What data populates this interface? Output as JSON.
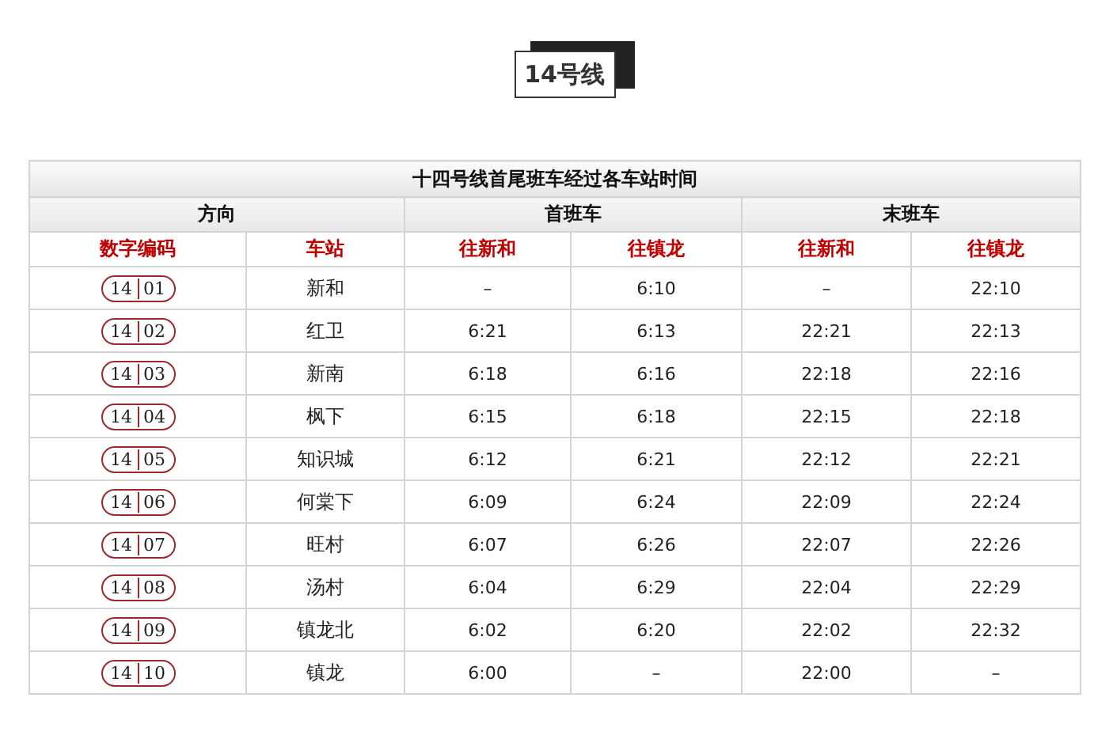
{
  "heading": "14号线",
  "table": {
    "title": "十四号线首尾班车经过各车站时间",
    "groups": [
      "方向",
      "首班车",
      "末班车"
    ],
    "columns": [
      "数字编码",
      "车站",
      "往新和",
      "往镇龙",
      "往新和",
      "往镇龙"
    ],
    "rows": [
      {
        "line": "14",
        "code": "01",
        "station": "新和",
        "times": [
          "–",
          "6:10",
          "–",
          "22:10"
        ]
      },
      {
        "line": "14",
        "code": "02",
        "station": "红卫",
        "times": [
          "6:21",
          "6:13",
          "22:21",
          "22:13"
        ]
      },
      {
        "line": "14",
        "code": "03",
        "station": "新南",
        "times": [
          "6:18",
          "6:16",
          "22:18",
          "22:16"
        ]
      },
      {
        "line": "14",
        "code": "04",
        "station": "枫下",
        "times": [
          "6:15",
          "6:18",
          "22:15",
          "22:18"
        ]
      },
      {
        "line": "14",
        "code": "05",
        "station": "知识城",
        "times": [
          "6:12",
          "6:21",
          "22:12",
          "22:21"
        ]
      },
      {
        "line": "14",
        "code": "06",
        "station": "何棠下",
        "times": [
          "6:09",
          "6:24",
          "22:09",
          "22:24"
        ]
      },
      {
        "line": "14",
        "code": "07",
        "station": "旺村",
        "times": [
          "6:07",
          "6:26",
          "22:07",
          "22:26"
        ]
      },
      {
        "line": "14",
        "code": "08",
        "station": "汤村",
        "times": [
          "6:04",
          "6:29",
          "22:04",
          "22:29"
        ]
      },
      {
        "line": "14",
        "code": "09",
        "station": "镇龙北",
        "times": [
          "6:02",
          "6:20",
          "22:02",
          "22:32"
        ]
      },
      {
        "line": "14",
        "code": "10",
        "station": "镇龙",
        "times": [
          "6:00",
          "–",
          "22:00",
          "–"
        ]
      }
    ]
  }
}
